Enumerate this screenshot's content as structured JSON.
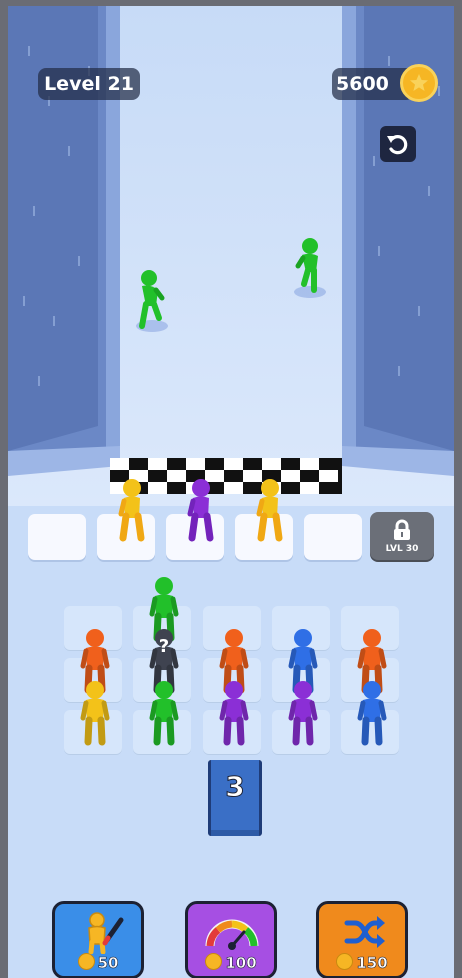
{
  "hud": {
    "level_label": "Level 21",
    "coins": "5600"
  },
  "slots": {
    "count": 5,
    "locked_label": "LVL 30"
  },
  "queue": {
    "count": "3"
  },
  "powerups": [
    {
      "name": "recolor",
      "icon": "paint-brush-person-icon",
      "cost": "50",
      "color": "#3a8ee8"
    },
    {
      "name": "speed",
      "icon": "speedometer-icon",
      "cost": "100",
      "color": "#a64fe3"
    },
    {
      "name": "shuffle",
      "icon": "shuffle-icon",
      "cost": "150",
      "color": "#f08a1c"
    }
  ],
  "runners": [
    {
      "color": "#22c02a",
      "role": "runner-left"
    },
    {
      "color": "#22c02a",
      "role": "runner-right"
    }
  ],
  "slot_occupants": [
    "#f3c219",
    "#8b2fd6",
    "#f3c219"
  ],
  "grid_figures": [
    {
      "row": 0,
      "col": 1,
      "color": "#22c02a"
    },
    {
      "row": 1,
      "col": 0,
      "color": "#f0601c"
    },
    {
      "row": 1,
      "col": 1,
      "color": "#3f4350",
      "hidden": "?"
    },
    {
      "row": 1,
      "col": 2,
      "color": "#f0601c"
    },
    {
      "row": 1,
      "col": 3,
      "color": "#2f6fe6"
    },
    {
      "row": 1,
      "col": 4,
      "color": "#f0601c"
    },
    {
      "row": 2,
      "col": 0,
      "color": "#f3c219"
    },
    {
      "row": 2,
      "col": 1,
      "color": "#22c02a"
    },
    {
      "row": 2,
      "col": 2,
      "color": "#8b2fd6"
    },
    {
      "row": 2,
      "col": 3,
      "color": "#8b2fd6"
    },
    {
      "row": 2,
      "col": 4,
      "color": "#2f6fe6"
    }
  ]
}
